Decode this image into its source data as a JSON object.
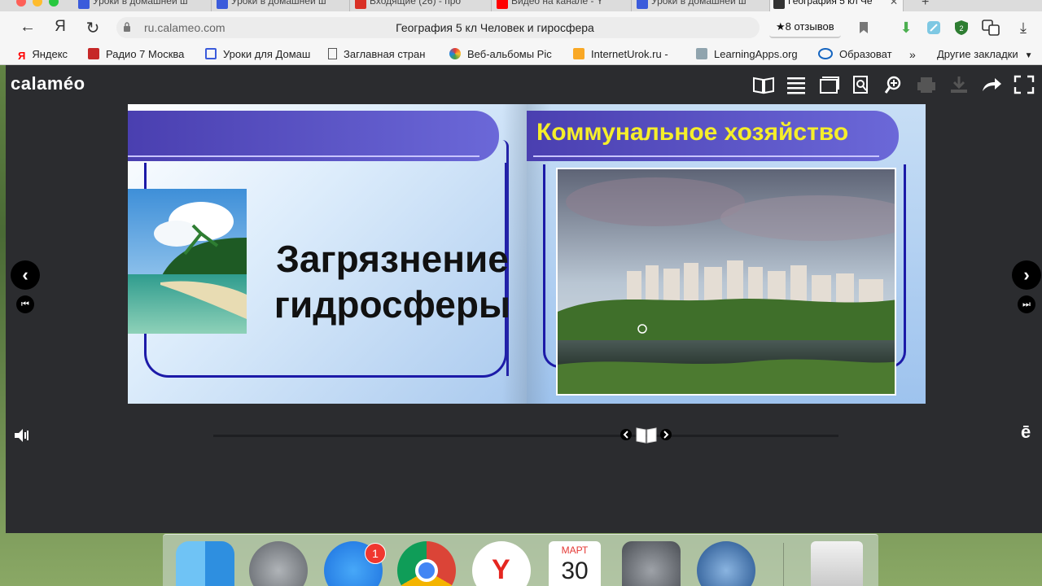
{
  "browser": {
    "tabs": [
      {
        "label": "Уроки в домашней ш",
        "color": "#3b5bdb",
        "active": false
      },
      {
        "label": "Уроки в домашней ш",
        "color": "#3b5bdb",
        "active": false
      },
      {
        "label": "Входящие (26) - про",
        "color": "#d93025",
        "active": false
      },
      {
        "label": "Видео на канале - Y",
        "color": "#ff0000",
        "active": false
      },
      {
        "label": "Уроки в домашней ш",
        "color": "#3b5bdb",
        "active": false
      },
      {
        "label": "География 5 кл Че",
        "color": "#333333",
        "active": true
      }
    ],
    "url_host": "ru.calameo.com",
    "page_title": "География 5 кл Человек и гиросфера",
    "reviews": "★8 отзывов",
    "ext_badge": "2",
    "yandex_btn": "Я"
  },
  "bookmarks": [
    {
      "label": "Яндекс",
      "icon": "yandex-icon"
    },
    {
      "label": "Радио 7 Москва",
      "icon": "radio-icon"
    },
    {
      "label": "Уроки для Домаш",
      "icon": "lessons-icon"
    },
    {
      "label": "Заглавная стран",
      "icon": "page-icon"
    },
    {
      "label": "Веб-альбомы Pic",
      "icon": "picasa-icon"
    },
    {
      "label": "InternetUrok.ru -",
      "icon": "internet-urok-icon"
    },
    {
      "label": "LearningApps.org",
      "icon": "learningapps-icon"
    },
    {
      "label": "Образоват",
      "icon": "intel-icon"
    },
    {
      "label": "»",
      "icon": "more-icon"
    },
    {
      "label": "Другие закладки",
      "icon": "folder-icon"
    }
  ],
  "viewer": {
    "logo": "calaméo",
    "left_page": {
      "heading_line1": "Загрязнение",
      "heading_line2": "гидросферы"
    },
    "right_page": {
      "heading": "Коммунальное хозяйство"
    },
    "e_label": "ē"
  },
  "dock": {
    "appstore_badge": "1",
    "calendar_month": "МАРТ",
    "calendar_day": "30"
  },
  "colors": {
    "viewer_bg": "#2b2c2f",
    "banner": "#4a3fb0",
    "frame": "#1c1aa8",
    "heading_yellow": "#f5ee2a"
  }
}
